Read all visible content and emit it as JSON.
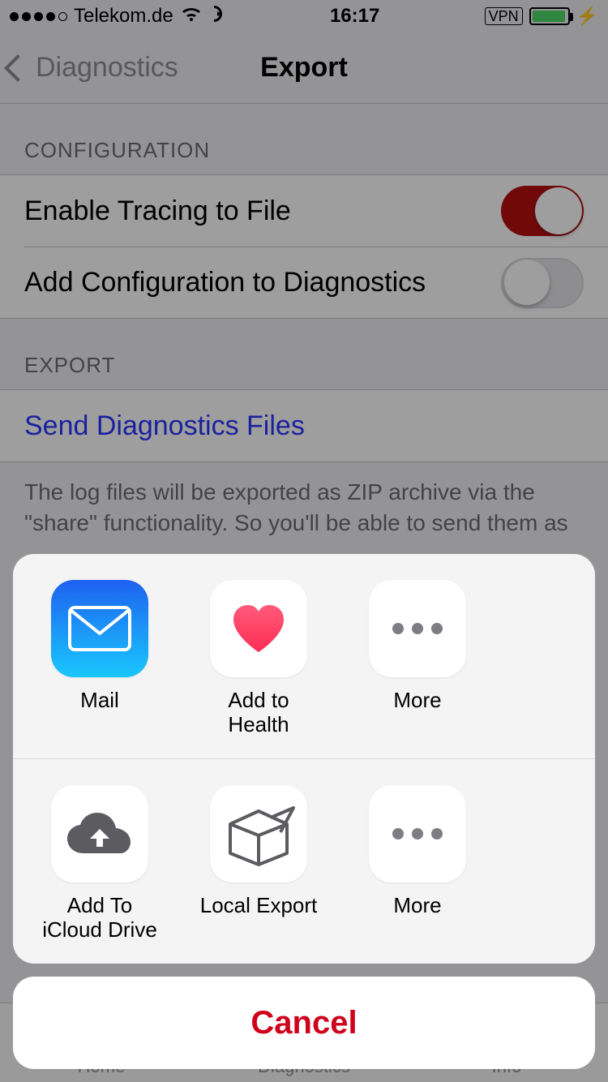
{
  "status": {
    "carrier": "Telekom.de",
    "time": "16:17",
    "vpn": "VPN"
  },
  "nav": {
    "back": "Diagnostics",
    "title": "Export"
  },
  "sections": {
    "config_header": "CONFIGURATION",
    "tracing_label": "Enable Tracing to File",
    "addconfig_label": "Add Configuration to Diagnostics",
    "export_header": "EXPORT",
    "send_label": "Send Diagnostics Files",
    "footer": "The log files will be exported as ZIP archive via the \"share\" functionality. So you'll be able to send them as"
  },
  "tabs": {
    "home": "Home",
    "diagnostics": "Diagnostics",
    "info": "Info"
  },
  "share": {
    "row1": {
      "mail": "Mail",
      "health": "Add to Health",
      "more": "More"
    },
    "row2": {
      "icloud": "Add To iCloud Drive",
      "local": "Local Export",
      "more": "More"
    },
    "cancel": "Cancel"
  }
}
